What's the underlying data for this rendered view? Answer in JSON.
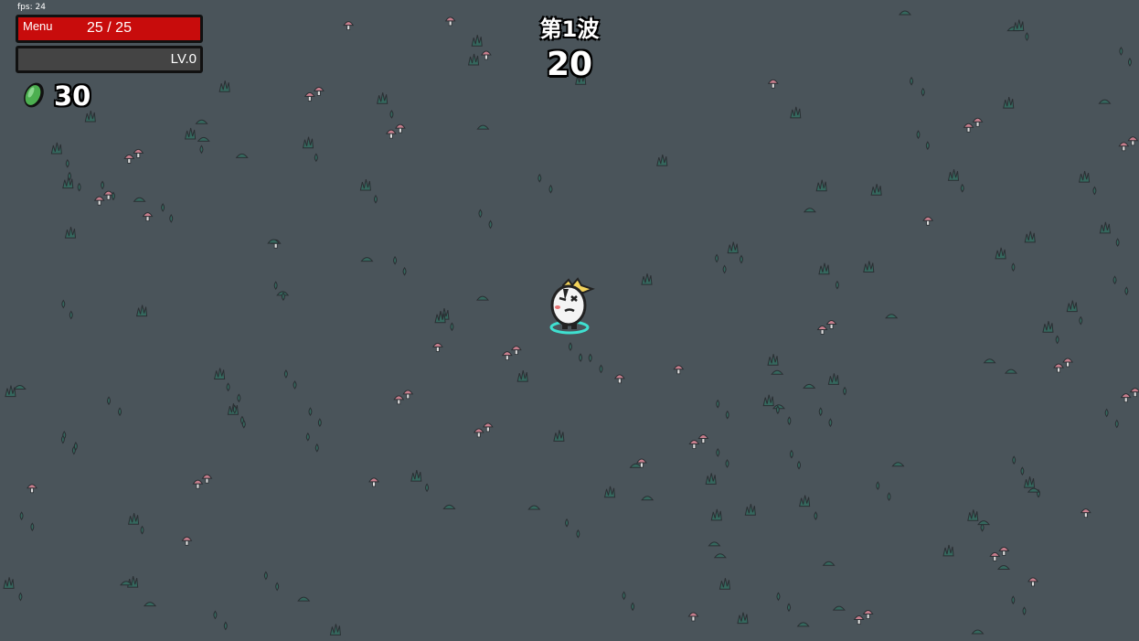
{
  "hud": {
    "fps_text": "fps: 24",
    "menu_label": "Menu",
    "hp_text": "25 / 25",
    "hp_fraction": 1.0,
    "level_text": "LV.0",
    "xp_fraction": 0.0,
    "materials_icon": "green-material-icon",
    "materials_count": "30"
  },
  "wave": {
    "label": "第1波",
    "timer": "20"
  },
  "colors": {
    "ground": "#4a545a",
    "hp": "#c80c0c",
    "xp": "#7ac943",
    "material": "#4caf50",
    "grass": "#35685e",
    "mushroom": "#c77d8c",
    "player_ring": "#3fe0d0"
  },
  "player": {
    "icon": "potato-player-icon"
  }
}
